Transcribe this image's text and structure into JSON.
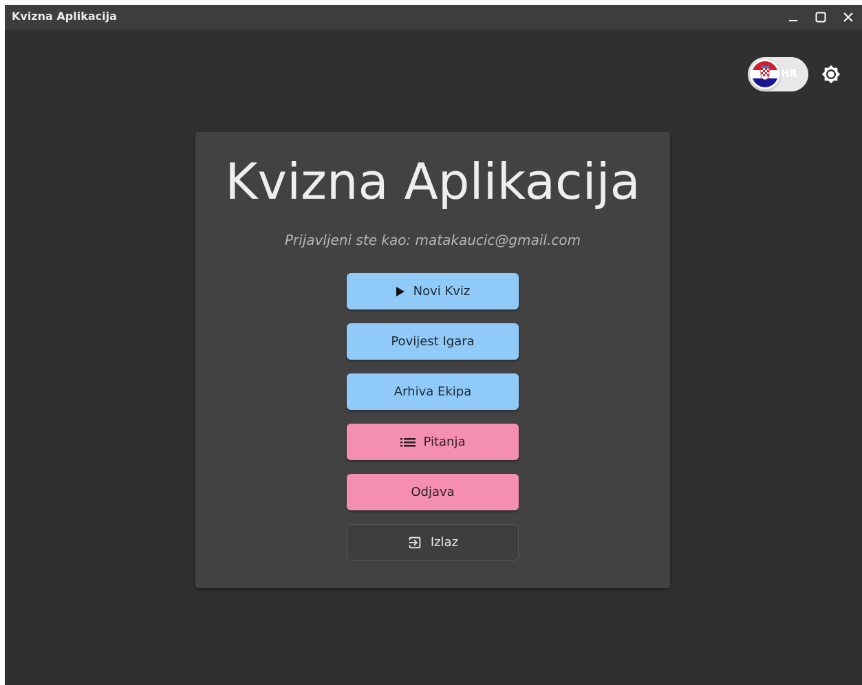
{
  "window": {
    "title": "Kvizna Aplikacija"
  },
  "header": {
    "language_code": "HR",
    "flag_icon": "croatia-flag-icon",
    "settings_icon": "brightness-icon"
  },
  "main": {
    "title": "Kvizna Aplikacija",
    "login_info": "Prijavljeni ste kao: matakaucic@gmail.com",
    "buttons": [
      {
        "label": "Novi Kviz",
        "icon": "play-icon",
        "color": "#90caf9"
      },
      {
        "label": "Povijest Igara",
        "color": "#90caf9"
      },
      {
        "label": "Arhiva Ekipa",
        "color": "#90caf9"
      },
      {
        "label": "Pitanja",
        "icon": "list-icon",
        "color": "#f48fb1"
      },
      {
        "label": "Odjava",
        "color": "#f48fb1"
      },
      {
        "label": "Izlaz",
        "icon": "exit-icon",
        "color": "#3e3e3e"
      }
    ]
  },
  "colors": {
    "background": "#303030",
    "card": "#424242",
    "titlebar": "#3d3d3d",
    "primary": "#90caf9",
    "secondary": "#f48fb1"
  }
}
